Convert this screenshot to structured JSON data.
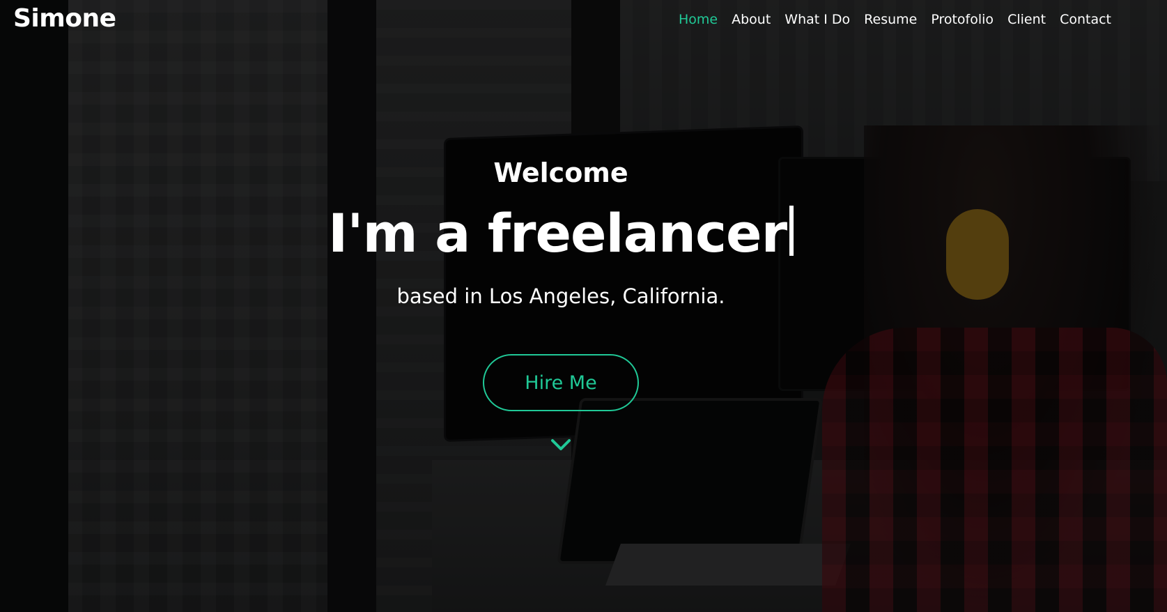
{
  "brand": {
    "name": "Simone"
  },
  "nav": {
    "items": [
      {
        "label": "Home",
        "active": true
      },
      {
        "label": "About"
      },
      {
        "label": "What I Do"
      },
      {
        "label": "Resume"
      },
      {
        "label": "Protofolio"
      },
      {
        "label": "Client"
      },
      {
        "label": "Contact"
      }
    ]
  },
  "hero": {
    "welcome": "Welcome",
    "headline": "I'm a freelancer",
    "subline": "based in Los Angeles, California.",
    "cta_label": "Hire Me",
    "scroll_icon": "chevron-down-icon"
  },
  "colors": {
    "accent": "#20c997",
    "text": "#ffffff",
    "overlay": "rgba(0,0,0,0.55)"
  }
}
